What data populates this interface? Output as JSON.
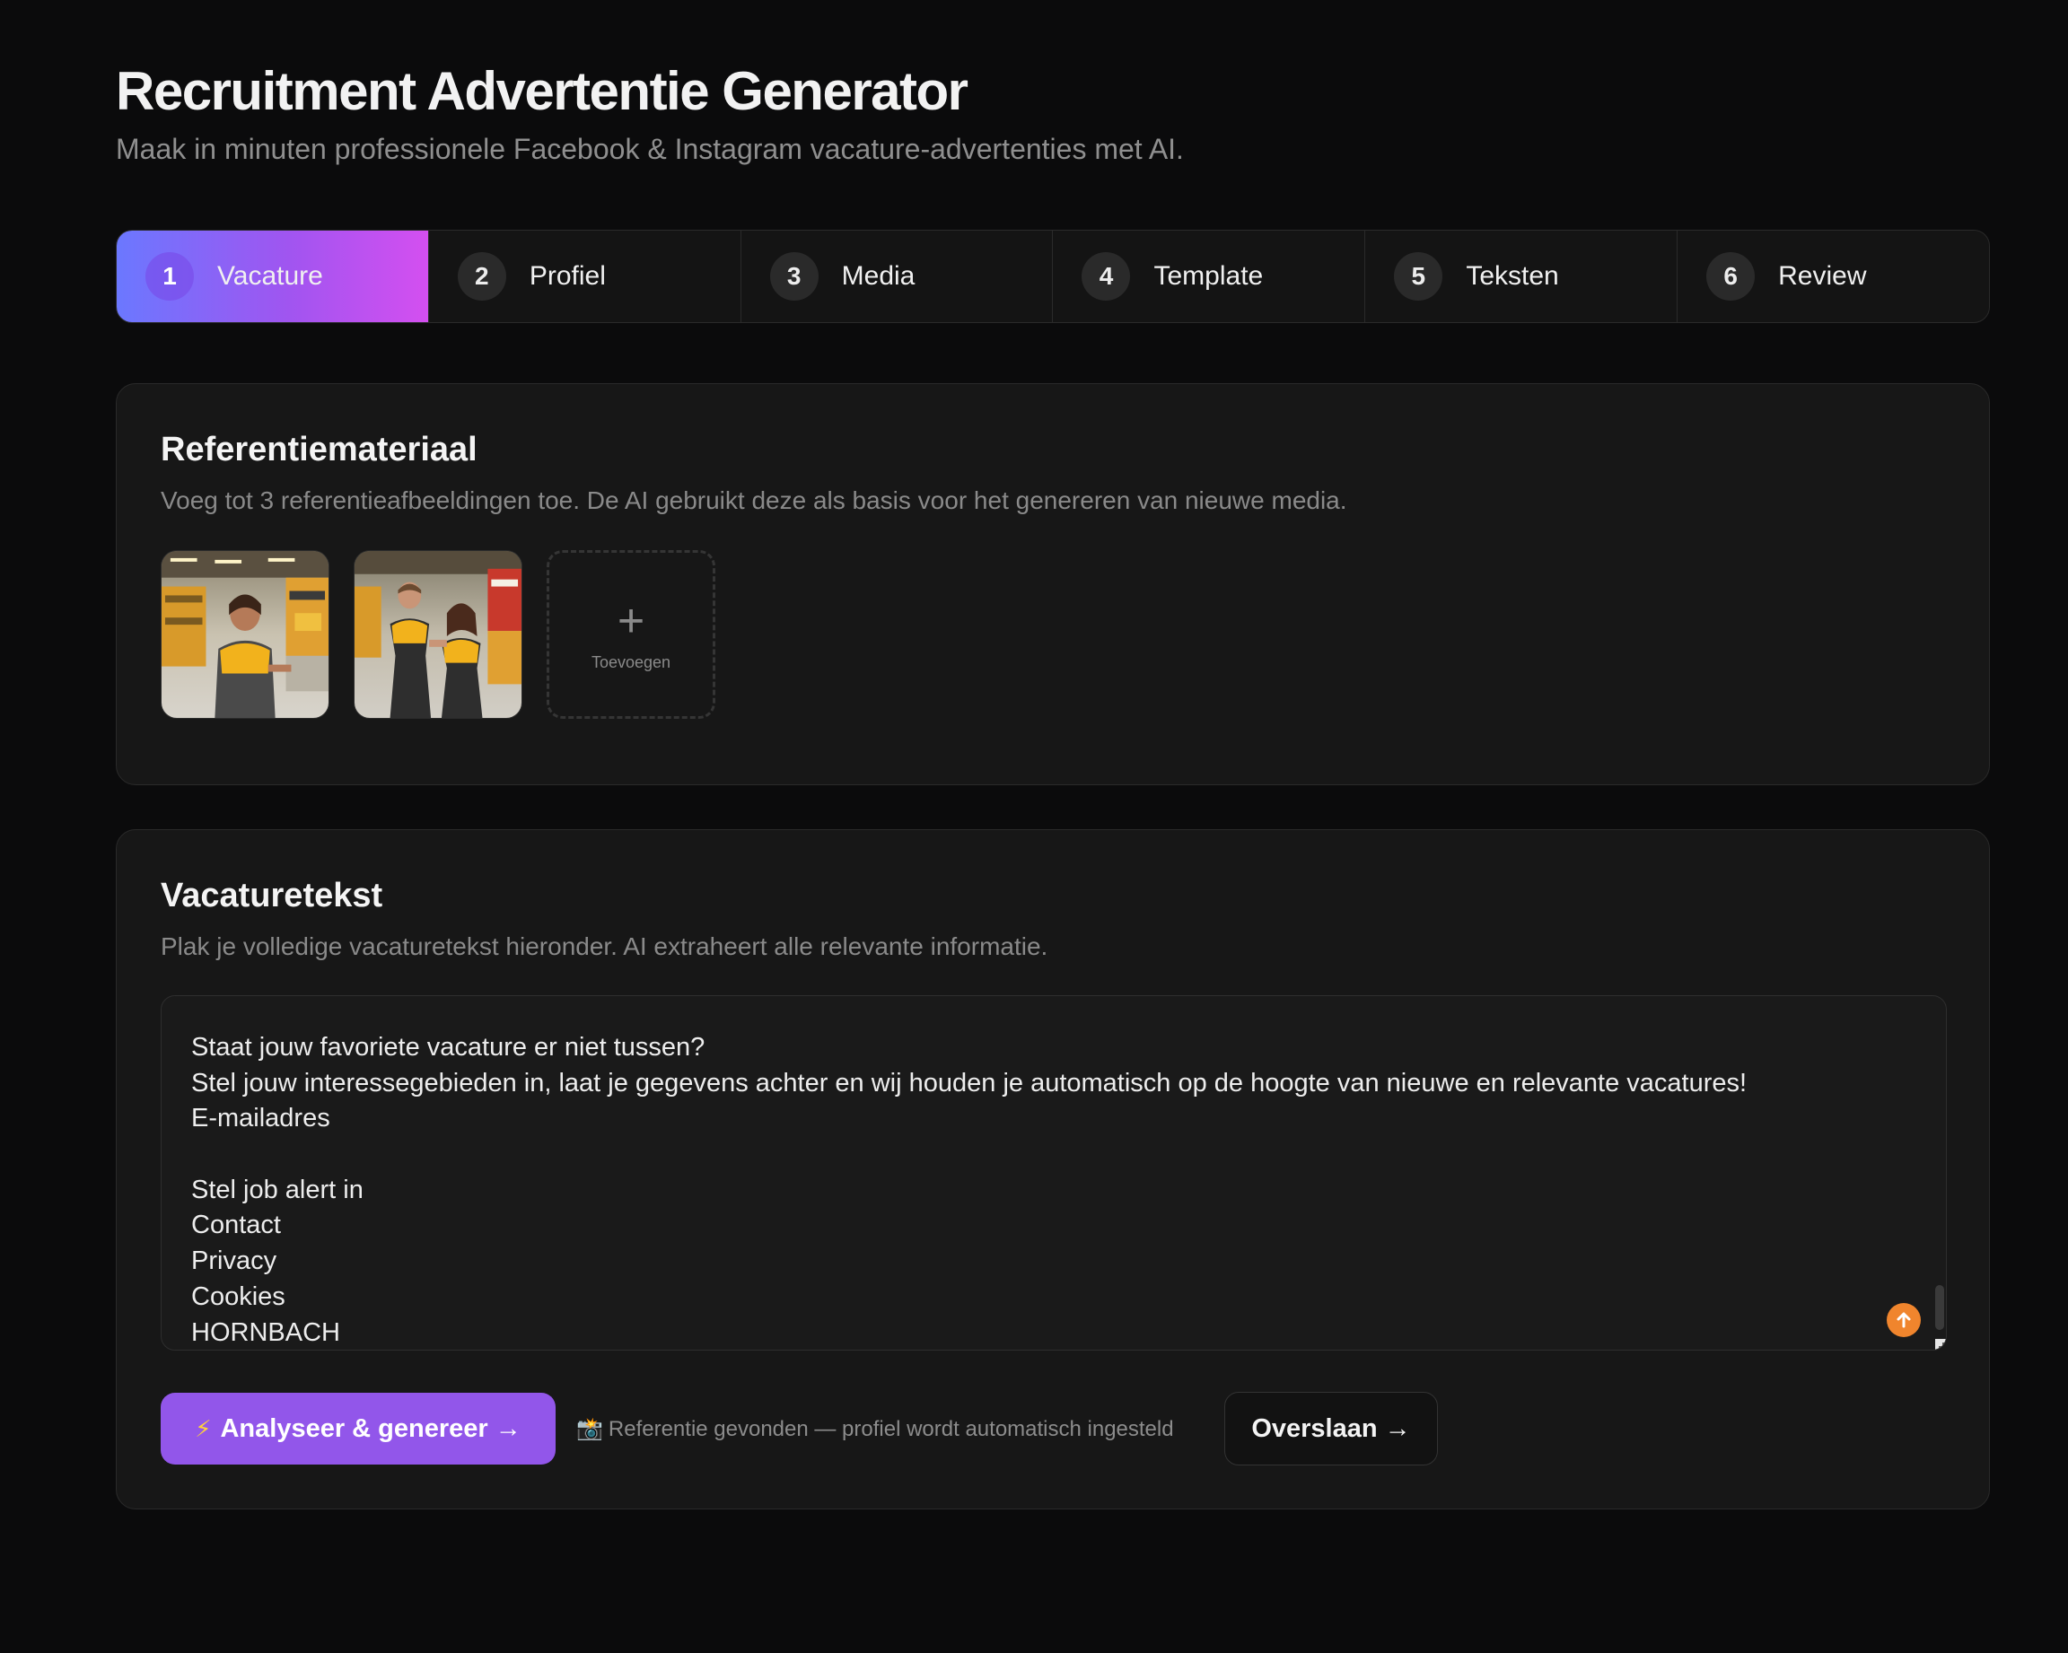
{
  "header": {
    "title": "Recruitment Advertentie Generator",
    "subtitle": "Maak in minuten professionele Facebook & Instagram vacature-advertenties met AI."
  },
  "stepper": {
    "active_step": 1,
    "steps": [
      {
        "number": "1",
        "label": "Vacature"
      },
      {
        "number": "2",
        "label": "Profiel"
      },
      {
        "number": "3",
        "label": "Media"
      },
      {
        "number": "4",
        "label": "Template"
      },
      {
        "number": "5",
        "label": "Teksten"
      },
      {
        "number": "6",
        "label": "Review"
      }
    ]
  },
  "reference": {
    "title": "Referentiemateriaal",
    "description": "Voeg tot 3 referentieafbeeldingen toe. De AI gebruikt deze als basis voor het genereren van nieuwe media.",
    "images": [
      "reference-image-warehouse-employee",
      "reference-image-two-employees"
    ],
    "add_label": "Toevoegen",
    "add_icon": "plus-icon"
  },
  "vacancy": {
    "title": "Vacaturetekst",
    "description": "Plak je volledige vacaturetekst hieronder. AI extraheert alle relevante informatie.",
    "text_lines": [
      "Staat jouw favoriete vacature er niet tussen?",
      "Stel jouw interessegebieden in, laat je gegevens achter en wij houden je automatisch op de hoogte van nieuwe en relevante vacatures!",
      "E-mailadres",
      "",
      "Stel job alert in",
      "Contact",
      "Privacy",
      "Cookies",
      "HORNBACH"
    ],
    "primary_button": {
      "icon": "⚡",
      "label": "Analyseer & genereer →"
    },
    "hint": {
      "icon": "📸",
      "text": "Referentie gevonden — profiel wordt automatisch ingesteld"
    },
    "secondary_button": {
      "label": "Overslaan →"
    }
  },
  "colors": {
    "background": "#0b0b0c",
    "card": "#171717",
    "accent": "#9256ea",
    "gradient_start": "#6b78ff",
    "gradient_end": "#d44ff0",
    "fab": "#f0852d"
  }
}
